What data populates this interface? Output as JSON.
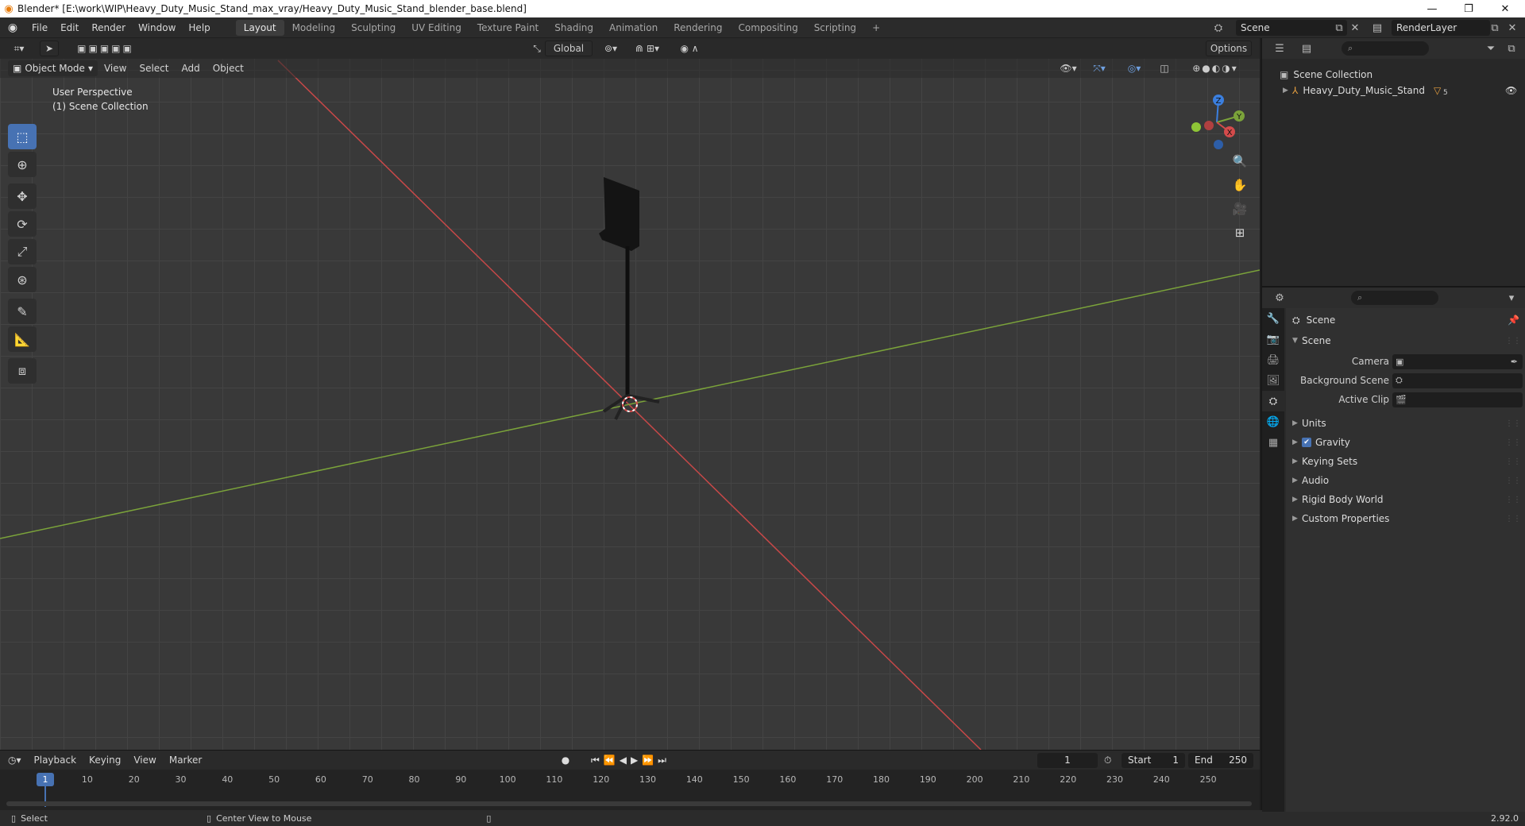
{
  "window": {
    "title": "Blender* [E:\\work\\WIP\\Heavy_Duty_Music_Stand_max_vray/Heavy_Duty_Music_Stand_blender_base.blend]",
    "minimize": "—",
    "maximize": "❐",
    "close": "✕"
  },
  "menu": {
    "items": [
      "File",
      "Edit",
      "Render",
      "Window",
      "Help"
    ]
  },
  "workspaces": {
    "tabs": [
      "Layout",
      "Modeling",
      "Sculpting",
      "UV Editing",
      "Texture Paint",
      "Shading",
      "Animation",
      "Rendering",
      "Compositing",
      "Scripting"
    ],
    "active": "Layout",
    "add_label": "+"
  },
  "scene_selector": {
    "value": "Scene"
  },
  "renderlayer_selector": {
    "value": "RenderLayer"
  },
  "viewport": {
    "transform_orientation": "Global",
    "options_label": "Options",
    "mode": "Object Mode",
    "header_menus": [
      "View",
      "Select",
      "Add",
      "Object"
    ],
    "overlay_line1": "User Perspective",
    "overlay_line2": "(1) Scene Collection",
    "gizmo": {
      "z": "Z",
      "y": "Y",
      "x": "X"
    }
  },
  "timeline": {
    "menus": [
      "Playback",
      "Keying",
      "View",
      "Marker"
    ],
    "current_frame": "1",
    "start_label": "Start",
    "start_value": "1",
    "end_label": "End",
    "end_value": "250",
    "playhead": "1",
    "ticks": [
      "10",
      "20",
      "30",
      "40",
      "50",
      "60",
      "70",
      "80",
      "90",
      "100",
      "110",
      "120",
      "130",
      "140",
      "150",
      "160",
      "170",
      "180",
      "190",
      "200",
      "210",
      "220",
      "230",
      "240",
      "250"
    ]
  },
  "statusbar": {
    "left": "Select",
    "middle": "Center View to Mouse",
    "version": "2.92.0"
  },
  "outliner": {
    "root": "Scene Collection",
    "object": "Heavy_Duty_Music_Stand",
    "modifier_badge": "5"
  },
  "properties": {
    "context_title": "Scene",
    "section_title": "Scene",
    "camera_label": "Camera",
    "background_scene_label": "Background Scene",
    "active_clip_label": "Active Clip",
    "panels": [
      "Units",
      "Gravity",
      "Keying Sets",
      "Audio",
      "Rigid Body World",
      "Custom Properties"
    ],
    "gravity_checked": true
  },
  "colors": {
    "accent": "#4772b3",
    "x_axis": "#d44b4b",
    "y_axis": "#7ba33a",
    "z_axis": "#3b7fdf"
  }
}
